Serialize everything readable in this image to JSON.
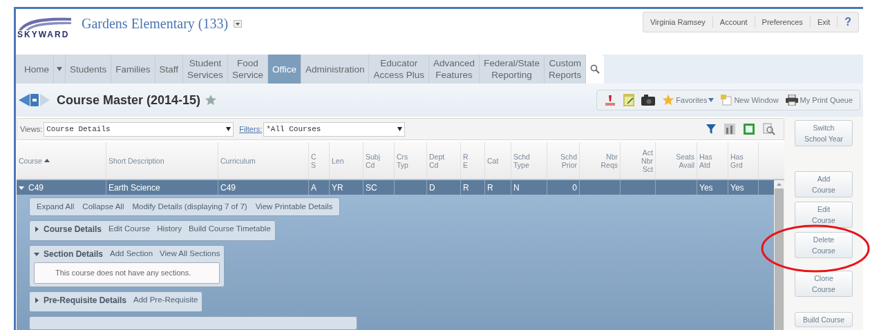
{
  "header": {
    "logo_text": "SKYWARD",
    "school": "Gardens Elementary (133)",
    "user_links": [
      "Virginia Ramsey",
      "Account",
      "Preferences",
      "Exit",
      "?"
    ]
  },
  "nav": [
    {
      "label": "Home",
      "selected": false,
      "dropdown": true
    },
    {
      "label": "Students",
      "selected": false,
      "dropdown": false
    },
    {
      "label": "Families",
      "selected": false,
      "dropdown": false
    },
    {
      "label": "Staff",
      "selected": false,
      "dropdown": false
    },
    {
      "label": "Student\nServices",
      "selected": false,
      "dropdown": false
    },
    {
      "label": "Food\nService",
      "selected": false,
      "dropdown": false
    },
    {
      "label": "Office",
      "selected": true,
      "dropdown": false
    },
    {
      "label": "Administration",
      "selected": false,
      "dropdown": false
    },
    {
      "label": "Educator\nAccess Plus",
      "selected": false,
      "dropdown": false
    },
    {
      "label": "Advanced\nFeatures",
      "selected": false,
      "dropdown": false
    },
    {
      "label": "Federal/State\nReporting",
      "selected": false,
      "dropdown": false
    },
    {
      "label": "Custom\nReports",
      "selected": false,
      "dropdown": false
    }
  ],
  "page": {
    "title": "Course Master (2014-15)",
    "toolbar": {
      "favorites": "Favorites",
      "new_window": "New Window",
      "print_queue": "My Print Queue"
    }
  },
  "views": {
    "label": "Views:",
    "value": "Course Details",
    "filters_label": "Filters:",
    "filter_value": "*All Courses"
  },
  "table": {
    "columns": [
      {
        "label": "Course",
        "sorted": true
      },
      {
        "label": "Short Description",
        "sorted": false
      },
      {
        "label": "Curriculum",
        "sorted": false
      },
      {
        "label": "C\nS",
        "sorted": false
      },
      {
        "label": "Len",
        "sorted": false
      },
      {
        "label": "Subj\nCd",
        "sorted": false
      },
      {
        "label": "Crs\nTyp",
        "sorted": false
      },
      {
        "label": "Dept\nCd",
        "sorted": false
      },
      {
        "label": "R\nE",
        "sorted": false
      },
      {
        "label": "Cat",
        "sorted": false
      },
      {
        "label": "Schd\nType",
        "sorted": false
      },
      {
        "label": "Schd\nPrior",
        "sorted": false
      },
      {
        "label": "Nbr\nReqs",
        "sorted": false
      },
      {
        "label": "Act\nNbr\nSct",
        "sorted": false
      },
      {
        "label": "Seats\nAvail",
        "sorted": false
      },
      {
        "label": "Has\nAtd",
        "sorted": false
      },
      {
        "label": "Has\nGrd",
        "sorted": false
      }
    ],
    "rows": [
      {
        "expanded": true,
        "selected": true,
        "cells": [
          "C49",
          "Earth Science",
          "C49",
          "A",
          "YR",
          "SC",
          "",
          "D",
          "R",
          "R",
          "N",
          "0",
          "",
          "",
          "",
          "Yes",
          "Yes"
        ]
      }
    ]
  },
  "details": {
    "actions": [
      "Expand All",
      "Collapse All",
      "Modify Details (displaying 7 of 7)",
      "View Printable Details"
    ],
    "panels": [
      {
        "title": "Course Details",
        "expanded": false,
        "links": [
          "Edit Course",
          "History",
          "Build Course Timetable"
        ]
      },
      {
        "title": "Section Details",
        "expanded": true,
        "links": [
          "Add Section",
          "View All Sections"
        ],
        "message": "This course does not have any sections."
      },
      {
        "title": "Pre-Requisite Details",
        "expanded": false,
        "links": [
          "Add Pre-Requisite"
        ]
      }
    ]
  },
  "side_buttons": [
    "Switch\nSchool Year",
    "Add\nCourse",
    "Edit\nCourse",
    "Delete\nCourse",
    "Clone\nCourse",
    "Build Course"
  ]
}
